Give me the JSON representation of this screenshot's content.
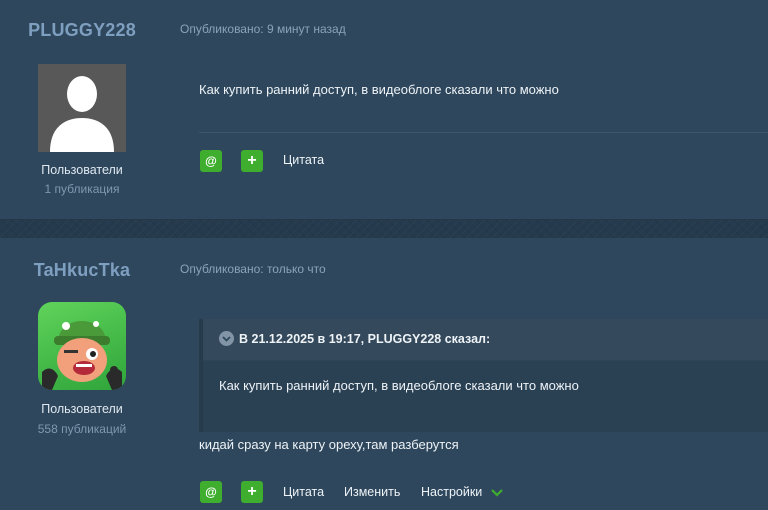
{
  "posts": [
    {
      "author": "PLUGGY228",
      "published": "Опубликовано: 9 минут назад",
      "avatar": "default-user-silhouette",
      "role": "Пользователи",
      "post_count": "1 публикация",
      "text": "Как купить ранний доступ, в видеоблоге сказали что можно",
      "actions": {
        "mention": "@",
        "plus": "+",
        "quote": "Цитата"
      }
    },
    {
      "author": "TaHkucTka",
      "published": "Опубликовано: только что",
      "avatar": "cartoon-character",
      "role": "Пользователи",
      "post_count": "558 публикаций",
      "quote": {
        "citation": "В 21.12.2025 в 19:17, PLUGGY228 сказал:",
        "text": "Как купить ранний доступ, в видеоблоге сказали что можно"
      },
      "text": "кидай сразу на карту ореху,там разберутся",
      "actions": {
        "mention": "@",
        "plus": "+",
        "quote": "Цитата",
        "edit": "Изменить",
        "settings": "Настройки"
      }
    }
  ],
  "colors": {
    "accent_green": "#3fae2e",
    "author_name": "#7f9fc0",
    "background": "#2e475c"
  }
}
